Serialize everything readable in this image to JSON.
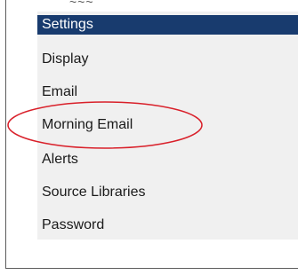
{
  "window": {
    "cutoff_title": "~~~"
  },
  "menu": {
    "items": [
      {
        "label": "Settings",
        "selected": true
      },
      {
        "label": "Display"
      },
      {
        "label": "Email"
      },
      {
        "label": "Morning Email",
        "annotated": true
      },
      {
        "label": "Alerts"
      },
      {
        "label": "Source Libraries"
      },
      {
        "label": "Password"
      }
    ]
  },
  "colors": {
    "selected_bg": "#183b6e",
    "menu_bg": "#f0f0f0",
    "annotation": "#d9202a"
  }
}
